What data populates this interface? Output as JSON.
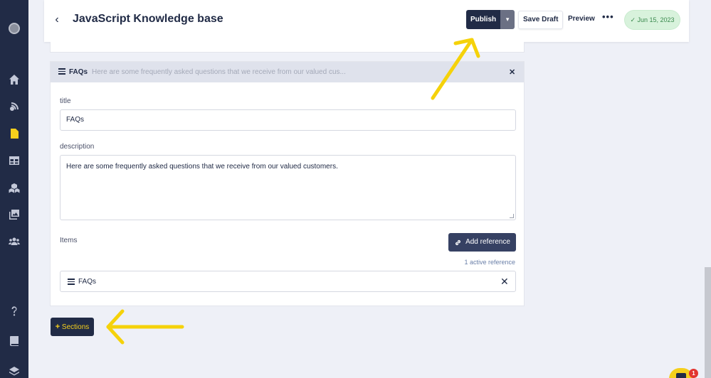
{
  "header": {
    "back_icon": "chevron-left-icon",
    "title": "JavaScript Knowledge base",
    "publish_label": "Publish",
    "publish_caret": "▾",
    "save_draft_label": "Save Draft",
    "preview_label": "Preview",
    "more_label": "•••",
    "date_badge": "✓ Jun 15, 2023"
  },
  "sidebar": {
    "items": [
      {
        "name": "avatar"
      },
      {
        "name": "home-icon"
      },
      {
        "name": "broadcast-icon"
      },
      {
        "name": "document-icon",
        "active": true
      },
      {
        "name": "table-icon"
      },
      {
        "name": "cubes-icon"
      },
      {
        "name": "images-icon"
      },
      {
        "name": "users-icon"
      },
      {
        "name": "help-icon"
      },
      {
        "name": "book-icon"
      },
      {
        "name": "layers-icon"
      }
    ]
  },
  "section": {
    "name": "FAQs",
    "description_preview": "Here are some frequently asked questions that we receive from our valued cus...",
    "close_label": "✕",
    "title_label": "title",
    "title_value": "FAQs",
    "description_label": "description",
    "description_value": "Here are some frequently asked questions that we receive from our valued customers.",
    "items_label": "Items",
    "add_reference_label": "Add reference",
    "active_reference_count": "1 active reference",
    "references": [
      {
        "label": "FAQs",
        "remove": "✕"
      }
    ]
  },
  "sections_button": {
    "plus": "+",
    "label": "Sections"
  },
  "chat": {
    "badge": "1"
  },
  "colors": {
    "sidebar": "#212b46",
    "accent_yellow": "#f5cf1c",
    "background": "#eef0f7",
    "section_header": "#dfe2ec",
    "date_badge": "#d8f2dc"
  }
}
